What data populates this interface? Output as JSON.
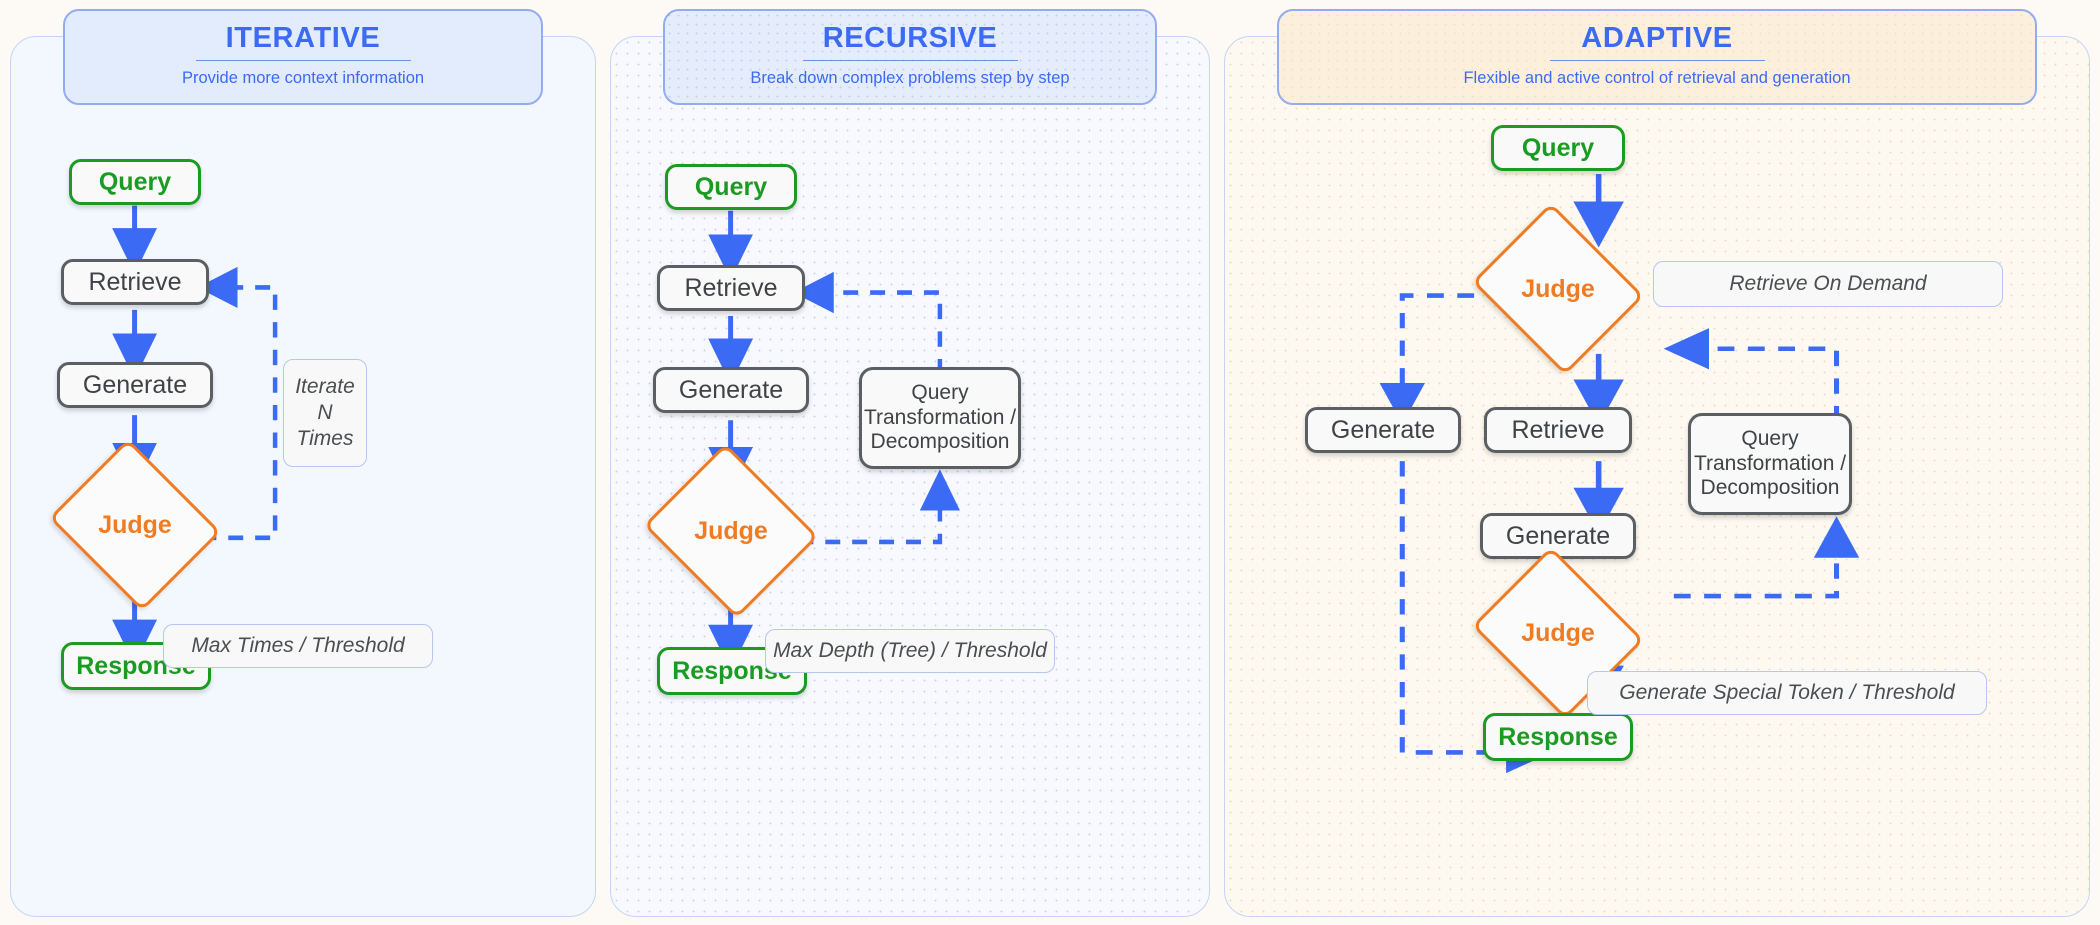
{
  "colors": {
    "accent_blue": "#3b6af5",
    "node_green": "#1a9c22",
    "node_gray": "#5b5f63",
    "decision_orange": "#ef7c23",
    "panel1_bg": "#f3f7fe",
    "panel2_bg": "#f7f9fe",
    "panel3_bg": "#fdf9f0",
    "header1_bg": "#e3ecfd",
    "header3_bg": "#fcefdc",
    "header_border": "#93abf0"
  },
  "panels": [
    {
      "id": "iterative",
      "title": "ITERATIVE",
      "subtitle": "Provide more context information",
      "nodes": {
        "query": "Query",
        "retrieve": "Retrieve",
        "generate": "Generate",
        "judge": "Judge",
        "response": "Response"
      },
      "notes": {
        "loop": "Iterate\nN\nTimes",
        "exit": "Max Times / Threshold"
      }
    },
    {
      "id": "recursive",
      "title": "RECURSIVE",
      "subtitle": "Break down complex problems step by step",
      "nodes": {
        "query": "Query",
        "retrieve": "Retrieve",
        "generate": "Generate",
        "judge": "Judge",
        "response": "Response",
        "transform": "Query\nTransformation /\nDecomposition"
      },
      "notes": {
        "exit": "Max Depth (Tree) / Threshold"
      }
    },
    {
      "id": "adaptive",
      "title": "ADAPTIVE",
      "subtitle": "Flexible and  active control of retrieval and generation",
      "nodes": {
        "query": "Query",
        "judge_top": "Judge",
        "retrieve": "Retrieve",
        "generate_left": "Generate",
        "generate_mid": "Generate",
        "judge_bottom": "Judge",
        "response": "Response",
        "transform": "Query\nTransformation /\nDecomposition"
      },
      "notes": {
        "demand": "Retrieve On  Demand",
        "exit": "Generate Special Token / Threshold"
      }
    }
  ]
}
